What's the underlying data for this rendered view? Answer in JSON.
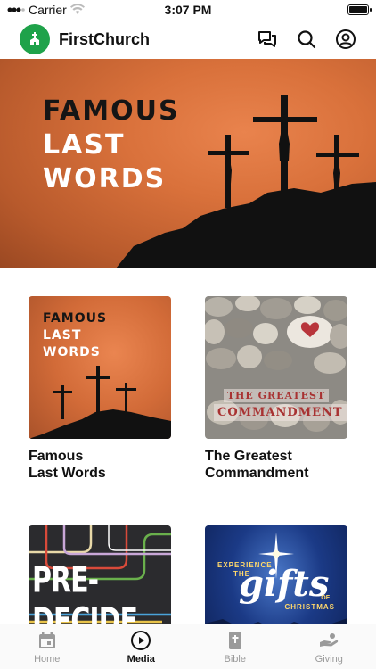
{
  "status": {
    "carrier": "Carrier",
    "time": "3:07 PM",
    "battery_level": 1.0
  },
  "header": {
    "app_name": "FirstChurch",
    "logo_text": "FirstChurch"
  },
  "hero": {
    "line1": "FAMOUS",
    "line2": "LAST",
    "line3": "WORDS"
  },
  "media": [
    {
      "title_line1": "Famous",
      "title_line2": "Last Words",
      "art": {
        "line1": "FAMOUS",
        "line2": "LAST",
        "line3": "WORDS"
      }
    },
    {
      "title_line1": "The Greatest",
      "title_line2": "Commandment",
      "art": {
        "line1": "THE GREATEST",
        "line2": "COMMANDMENT"
      }
    },
    {
      "title_line1": "",
      "title_line2": "",
      "art": {
        "text": "PRE-DECIDE"
      }
    },
    {
      "title_line1": "",
      "title_line2": "",
      "art": {
        "line1": "EXPERIENCE",
        "line2": "THE",
        "word": "gifts",
        "line3": "OF",
        "line4": "CHRISTMAS"
      }
    }
  ],
  "tabs": [
    {
      "label": "Home",
      "icon": "calendar-icon",
      "active": false
    },
    {
      "label": "Media",
      "icon": "play-circle-icon",
      "active": true
    },
    {
      "label": "Bible",
      "icon": "bible-icon",
      "active": false
    },
    {
      "label": "Giving",
      "icon": "giving-hand-icon",
      "active": false
    }
  ],
  "colors": {
    "brand": "#1fa24a",
    "hero_orange": "#d9713b",
    "active_tab": "#111111",
    "inactive_tab": "#9a9a9a"
  }
}
